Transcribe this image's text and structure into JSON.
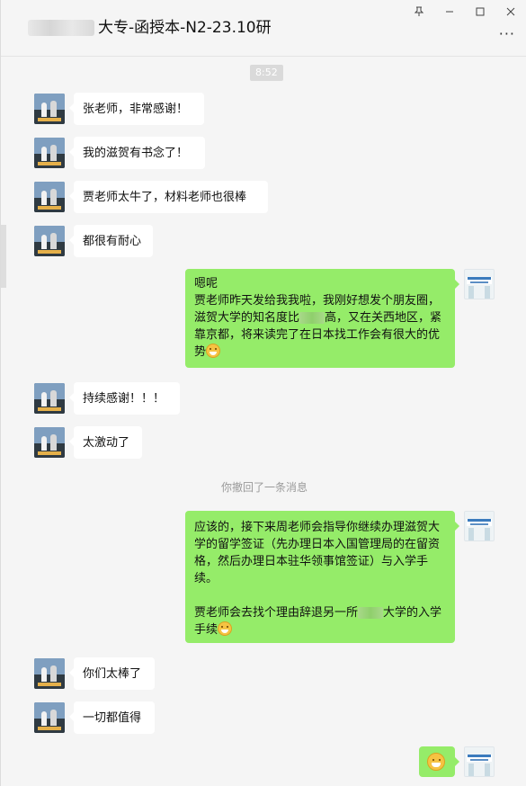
{
  "window": {
    "title": "大专-函授本-N2-23.10研",
    "controls": {
      "pin": "pin-icon",
      "minimize": "minimize-icon",
      "maximize": "maximize-icon",
      "close": "close-icon",
      "more": "more-icon"
    }
  },
  "chat": {
    "timestamp": "8:52",
    "system_notice": "你撤回了一条消息",
    "messages": [
      {
        "side": "in",
        "text": "张老师，非常感谢！"
      },
      {
        "side": "in",
        "text": "我的滋贺有书念了！"
      },
      {
        "side": "in",
        "text": "贾老师太牛了，材料老师也很棒"
      },
      {
        "side": "in",
        "text": "都很有耐心"
      },
      {
        "side": "out",
        "lines": [
          "嗯呢",
          "贾老师昨天发给我我啦，我刚好想发个朋友圈，滋贺大学的知名度比",
          "高，又在关西地区，紧靠京都，将来读完了在日本找工作会有很大的优势"
        ]
      },
      {
        "side": "in",
        "text": "持续感谢！！！"
      },
      {
        "side": "in",
        "text": "太激动了"
      },
      {
        "side": "out",
        "lines": [
          "应该的，接下来周老师会指导你继续办理滋贺大学的留学签证（先办理日本入国管理局的在留资格，然后办理日本驻华领事馆签证）与入学手续。",
          "贾老师会去找个理由辞退另一所",
          "大学的入学手续"
        ]
      },
      {
        "side": "in",
        "text": "你们太棒了"
      },
      {
        "side": "in",
        "text": "一切都值得"
      },
      {
        "side": "out",
        "emoji": "grin-emoji"
      }
    ]
  }
}
